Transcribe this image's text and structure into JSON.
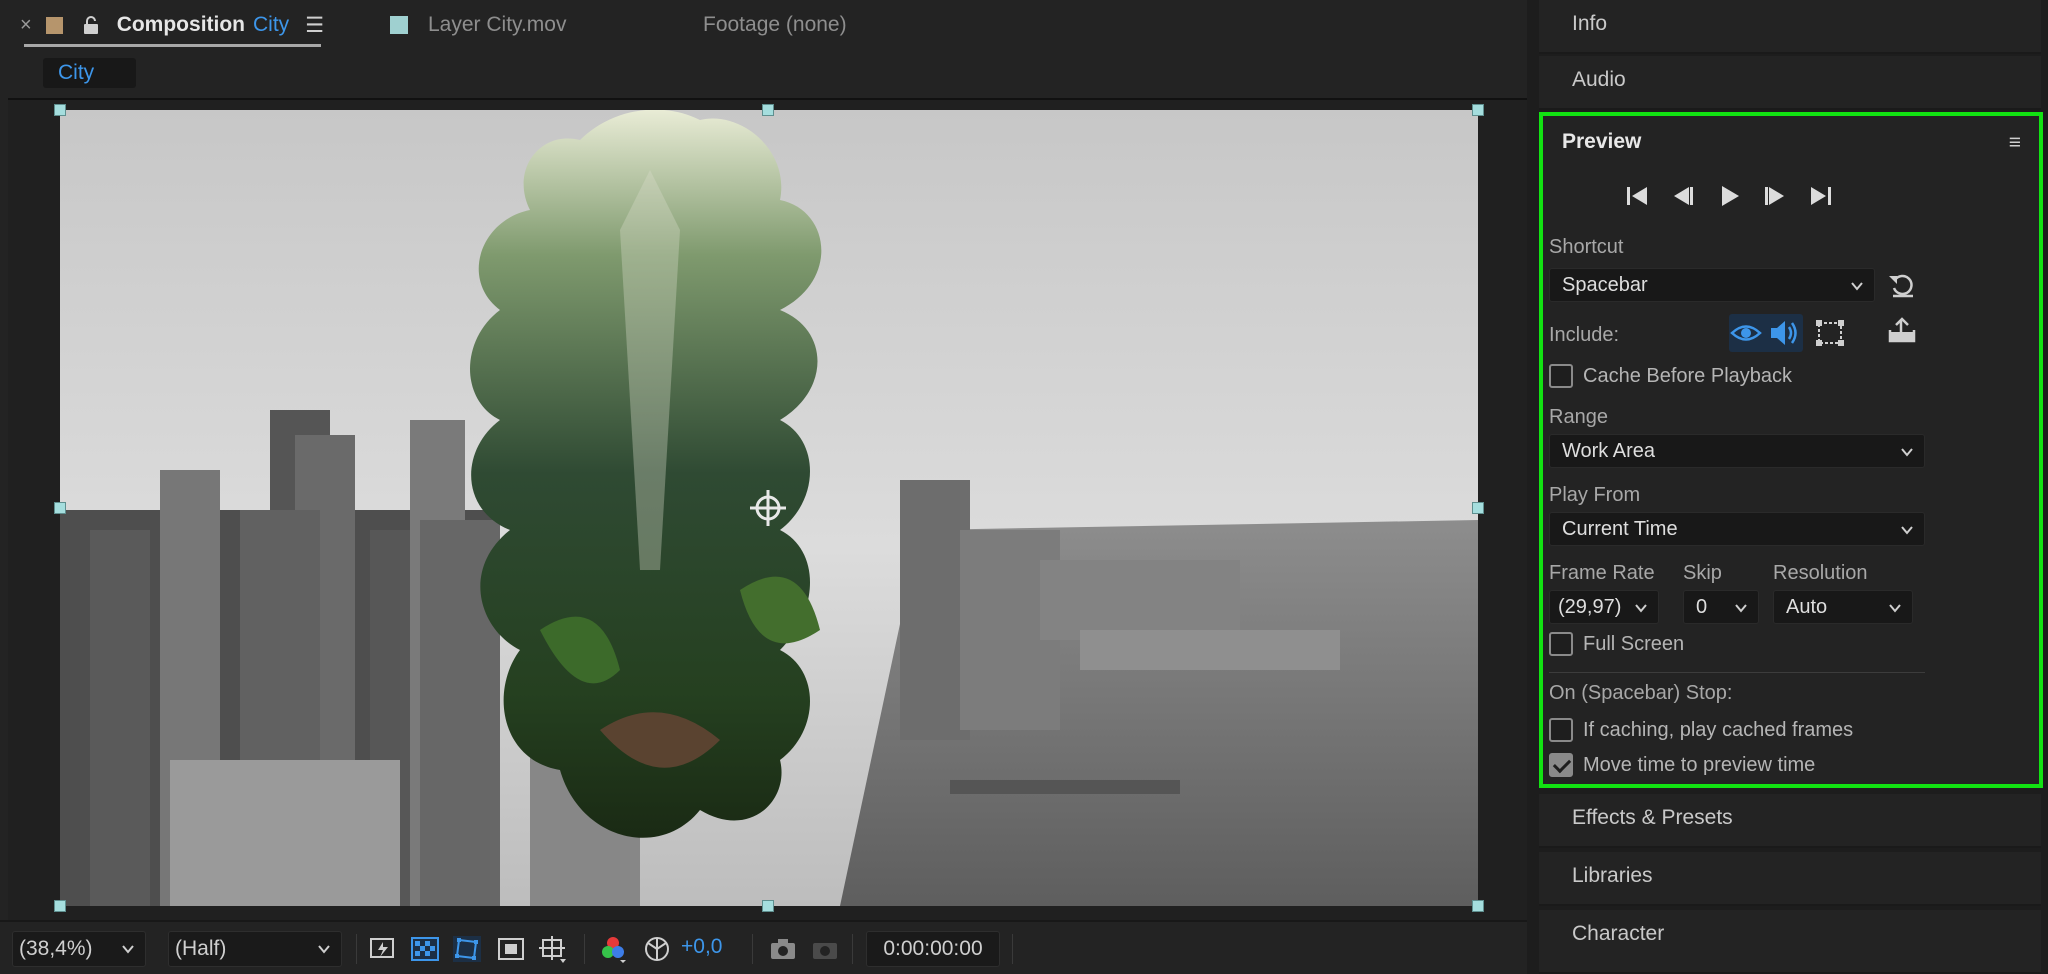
{
  "tabs": {
    "close": "×",
    "composition_word": "Composition",
    "composition_name": "City",
    "menu": "☰",
    "layer": "Layer City.mov",
    "footage": "Footage (none)"
  },
  "breadcrumb": "City",
  "viewer_toolbar": {
    "magnification": "(38,4%)",
    "resolution": "(Half)",
    "exposure": "+0,0",
    "timecode": "0:00:00:00"
  },
  "panels": {
    "info": "Info",
    "audio": "Audio",
    "effects": "Effects & Presets",
    "libraries": "Libraries",
    "character": "Character"
  },
  "preview": {
    "title": "Preview",
    "menu": "≡",
    "shortcut_label": "Shortcut",
    "shortcut_value": "Spacebar",
    "include_label": "Include:",
    "cache_before_playback": "Cache Before Playback",
    "range_label": "Range",
    "range_value": "Work Area",
    "play_from_label": "Play From",
    "play_from_value": "Current Time",
    "frame_rate_label": "Frame Rate",
    "skip_label": "Skip",
    "resolution_label": "Resolution",
    "frame_rate_value": "(29,97)",
    "skip_value": "0",
    "resolution_value": "Auto",
    "full_screen": "Full Screen",
    "stop_label": "On (Spacebar) Stop:",
    "if_caching": "If caching, play cached frames",
    "move_time": "Move time to preview time",
    "checks": {
      "cache_before_playback": false,
      "full_screen": false,
      "if_caching": false,
      "move_time": true
    }
  },
  "colors": {
    "accent_blue": "#3d96ea",
    "highlight_green": "#12e312",
    "panel_bg": "#232323"
  }
}
